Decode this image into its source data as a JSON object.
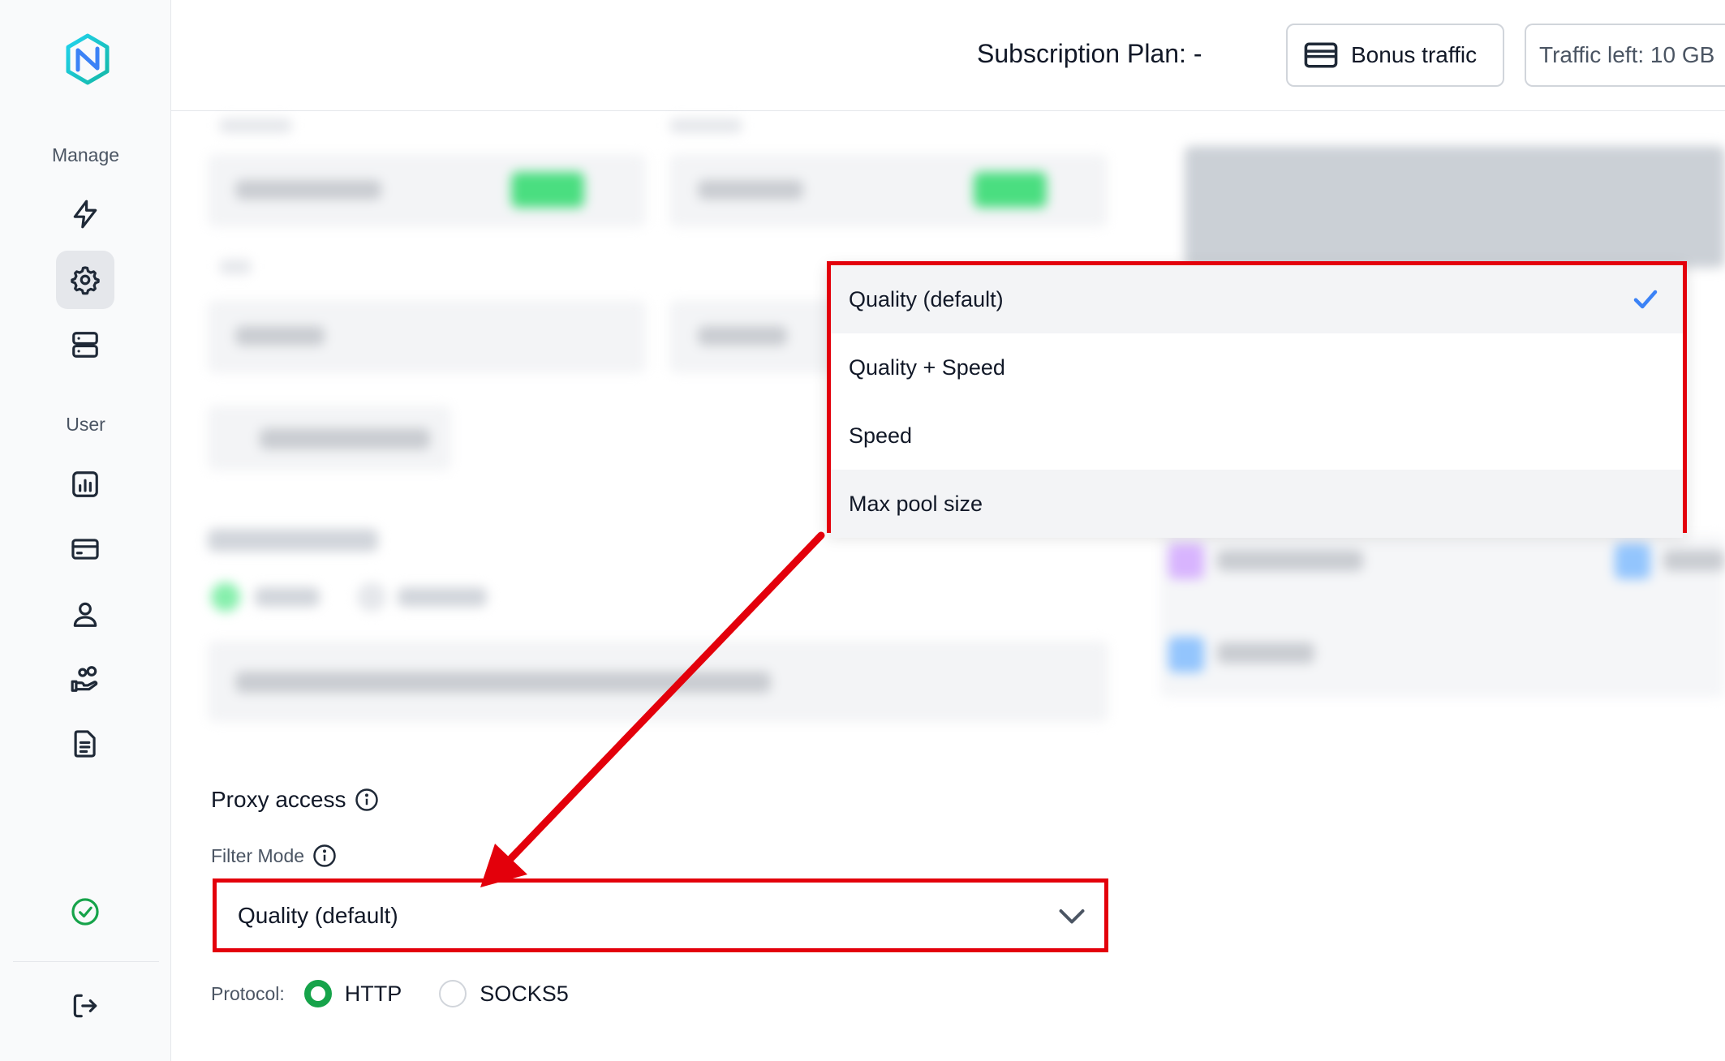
{
  "sidebar": {
    "manage_label": "Manage",
    "user_label": "User",
    "manage_items": [
      {
        "icon": "lightning-icon"
      },
      {
        "icon": "gear-icon"
      },
      {
        "icon": "server-icon"
      }
    ],
    "user_items": [
      {
        "icon": "bar-chart-icon"
      },
      {
        "icon": "credit-card-icon"
      },
      {
        "icon": "user-icon"
      },
      {
        "icon": "referral-hand-icon"
      },
      {
        "icon": "document-icon"
      }
    ],
    "status_icon": "check-circle-icon",
    "logout_icon": "logout-icon"
  },
  "header": {
    "subscription_plan": "Subscription Plan: -",
    "bonus_traffic_label": "Bonus traffic",
    "traffic_left": "Traffic left: 10 GB"
  },
  "filter_menu": {
    "options": [
      {
        "label": "Quality (default)",
        "selected": true
      },
      {
        "label": "Quality + Speed",
        "selected": false
      },
      {
        "label": "Speed",
        "selected": false
      },
      {
        "label": "Max pool size",
        "selected": false
      }
    ]
  },
  "proxy_access": {
    "title": "Proxy access",
    "filter_mode_label": "Filter Mode",
    "filter_mode_value": "Quality (default)",
    "protocol_label": "Protocol:",
    "protocols": [
      {
        "label": "HTTP",
        "selected": true
      },
      {
        "label": "SOCKS5",
        "selected": false
      }
    ]
  },
  "colors": {
    "highlight_red": "#e3000b",
    "accent_green": "#16a34a",
    "check_blue": "#3b82f6"
  }
}
